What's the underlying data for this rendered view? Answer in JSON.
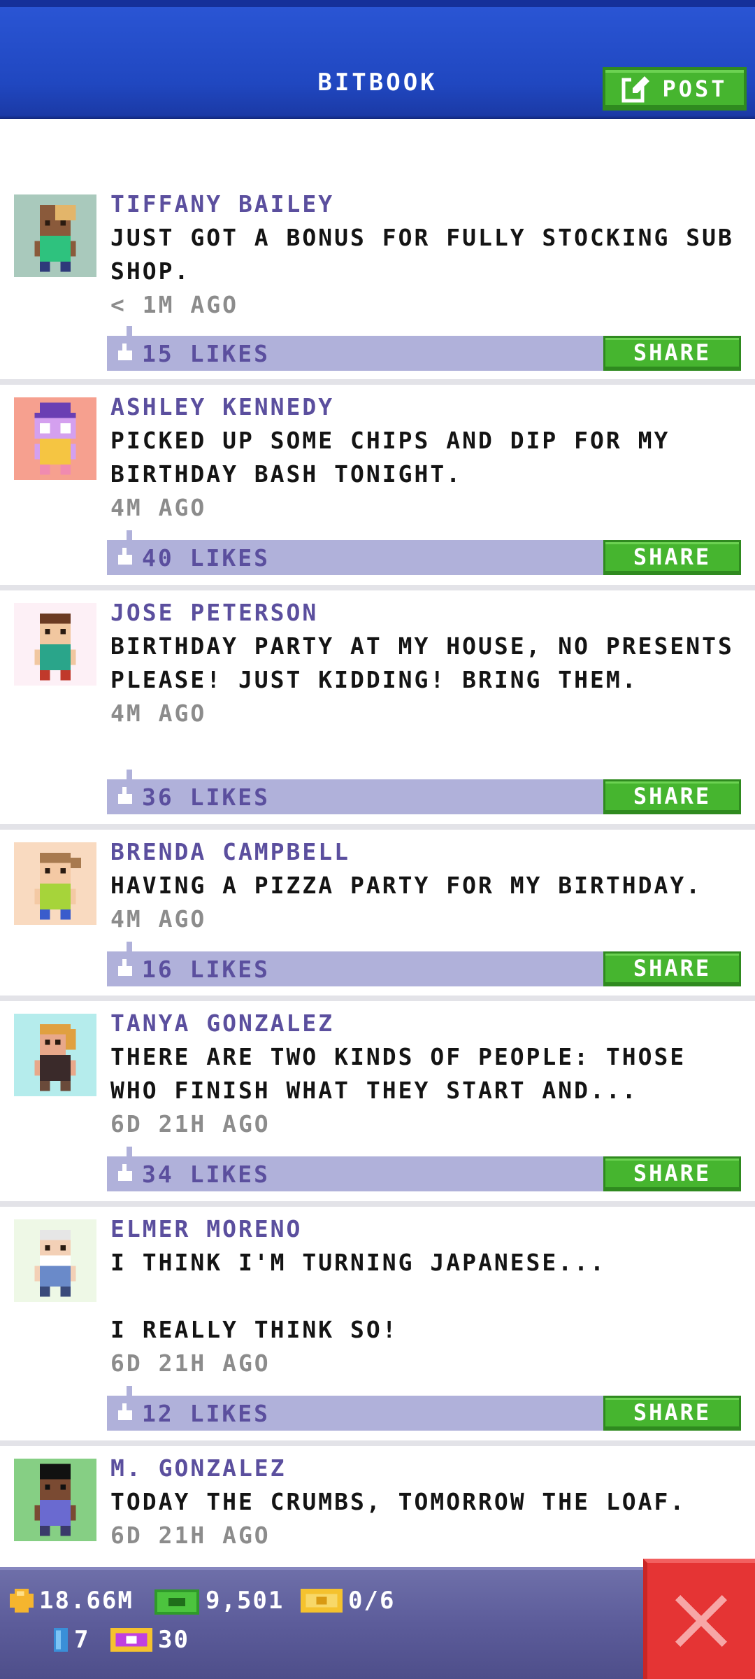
{
  "header": {
    "title": "BITBOOK",
    "post_label": "POST"
  },
  "posts": [
    {
      "name": "TIFFANY BAILEY",
      "text": "JUST GOT A BONUS FOR FULLY STOCKING SUB SHOP.",
      "time": "< 1M AGO",
      "likes": "15 LIKES",
      "share_label": "SHARE",
      "avatar_bg": "#a9c9bc"
    },
    {
      "name": "ASHLEY KENNEDY",
      "text": "PICKED UP SOME CHIPS AND DIP FOR MY BIRTHDAY BASH TONIGHT.",
      "time": "4M AGO",
      "likes": "40 LIKES",
      "share_label": "SHARE",
      "avatar_bg": "#f6a08f"
    },
    {
      "name": "JOSE PETERSON",
      "text": "BIRTHDAY PARTY AT MY HOUSE, NO PRESENTS PLEASE! JUST KIDDING! BRING THEM.",
      "time": "4M AGO",
      "likes": "36 LIKES",
      "share_label": "SHARE",
      "avatar_bg": "#fdf0f6"
    },
    {
      "name": "BRENDA CAMPBELL",
      "text": "HAVING A PIZZA PARTY FOR MY BIRTHDAY.",
      "time": "4M AGO",
      "likes": "16 LIKES",
      "share_label": "SHARE",
      "avatar_bg": "#f9dac0"
    },
    {
      "name": "TANYA GONZALEZ",
      "text": "THERE ARE TWO KINDS OF PEOPLE: THOSE WHO FINISH WHAT THEY START AND...",
      "time": "6D 21H AGO",
      "likes": "34 LIKES",
      "share_label": "SHARE",
      "avatar_bg": "#b5ecec"
    },
    {
      "name": "ELMER MORENO",
      "text": "I THINK I'M TURNING JAPANESE...\n\nI REALLY THINK SO!",
      "time": "6D 21H AGO",
      "likes": "12 LIKES",
      "share_label": "SHARE",
      "avatar_bg": "#eef8e6"
    },
    {
      "name": "M. GONZALEZ",
      "text": "TODAY THE CRUMBS, TOMORROW THE LOAF.",
      "time": "6D 21H AGO",
      "likes": "",
      "share_label": "",
      "avatar_bg": "#86cf84"
    }
  ],
  "status": {
    "coins": "18.66M",
    "bux": "9,501",
    "tickets": "0/6",
    "gems": "7",
    "vip": "30"
  },
  "colors": {
    "header_blue": "#2047c0",
    "accent_green": "#46b52f",
    "name_purple": "#5b4f9e",
    "like_bar": "#b0b1da",
    "close_red": "#e53434"
  }
}
